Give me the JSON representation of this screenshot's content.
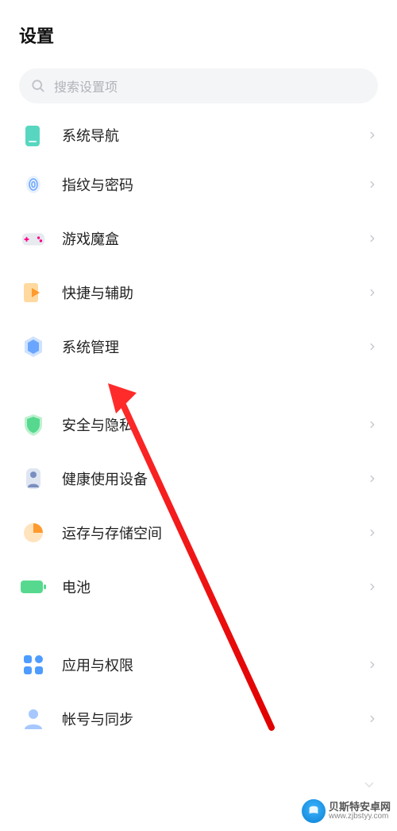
{
  "page_title": "设置",
  "search": {
    "placeholder": "搜索设置项"
  },
  "groups": [
    {
      "items": [
        {
          "key": "system-nav",
          "icon": "nav-icon",
          "label": "系统导航",
          "color": "#58d6c0"
        },
        {
          "key": "fingerprint-password",
          "icon": "fingerprint-icon",
          "label": "指纹与密码",
          "color": "#89c4ff"
        },
        {
          "key": "game-box",
          "icon": "gamepad-icon",
          "label": "游戏魔盒",
          "color": "#d0d4dc"
        },
        {
          "key": "shortcut-access",
          "icon": "shortcut-icon",
          "label": "快捷与辅助",
          "color": "#ffb648"
        },
        {
          "key": "system-manage",
          "icon": "hex-icon",
          "label": "系统管理",
          "color": "#6aa6ff"
        }
      ]
    },
    {
      "items": [
        {
          "key": "security-privacy",
          "icon": "shield-icon",
          "label": "安全与隐私",
          "color": "#56d98f"
        },
        {
          "key": "digital-wellbeing",
          "icon": "wellbeing-icon",
          "label": "健康使用设备",
          "color": "#8aa1d0"
        },
        {
          "key": "storage",
          "icon": "storage-icon",
          "label": "运存与存储空间",
          "color": "#ffb648"
        },
        {
          "key": "battery",
          "icon": "battery-icon",
          "label": "电池",
          "color": "#56d98f"
        }
      ]
    },
    {
      "items": [
        {
          "key": "apps-permissions",
          "icon": "apps-icon",
          "label": "应用与权限",
          "color": "#4e9cff"
        },
        {
          "key": "accounts-sync",
          "icon": "account-icon",
          "label": "帐号与同步",
          "color": "#a7c7ff"
        }
      ]
    }
  ],
  "annotation": {
    "highlight_key": "system-manage"
  },
  "watermark": {
    "line1": "贝斯特安卓网",
    "line2": "www.zjbstyy.com"
  }
}
